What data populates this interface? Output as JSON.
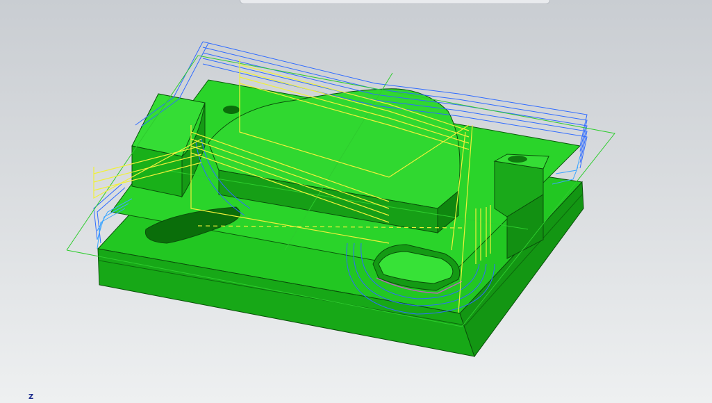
{
  "viewport": {
    "background_top": "#c9cdd2",
    "background_bottom": "#eef0f1",
    "axis_triad": {
      "z_label": "Z"
    }
  },
  "model": {
    "part_color": "#1fc41f",
    "toolpath_colors": {
      "contour": "#2f6bff",
      "rapid": "#f0f03a",
      "boundary": "#2ecc2e",
      "finish": "#c060c0"
    }
  }
}
